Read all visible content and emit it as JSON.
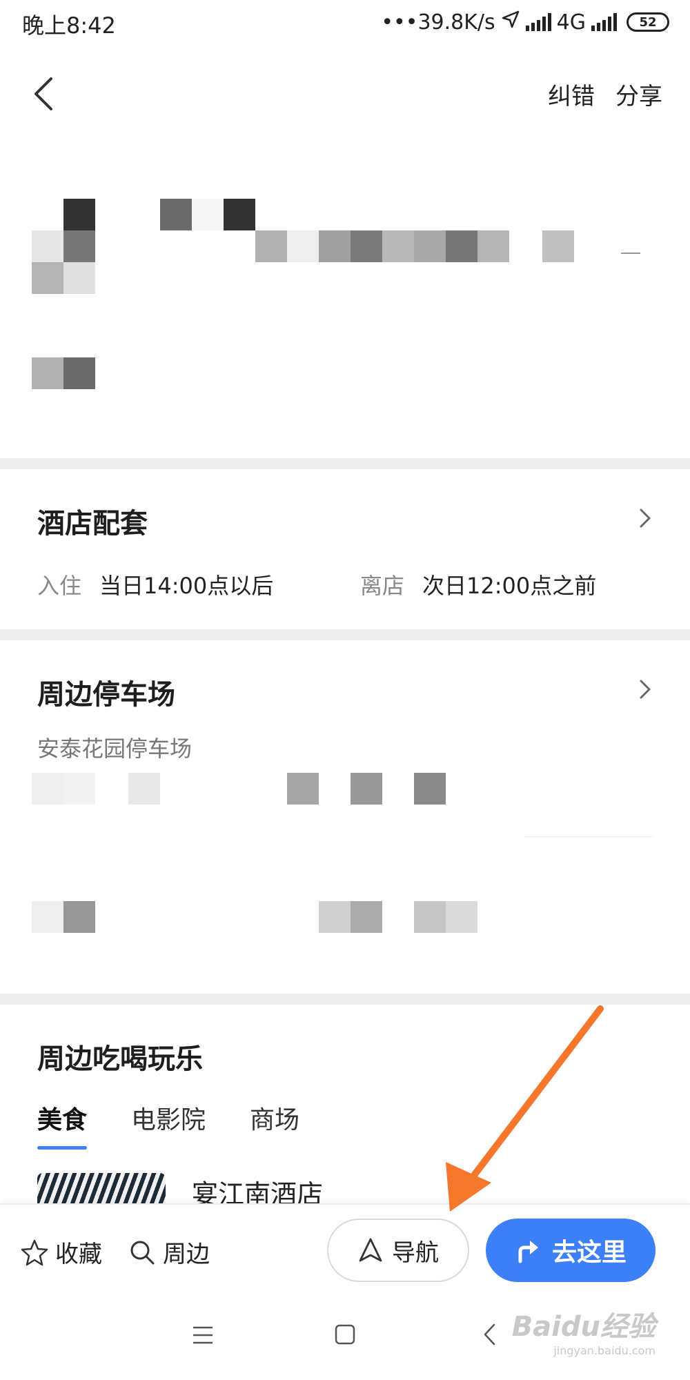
{
  "status_bar": {
    "time": "晚上8:42",
    "network_speed": "•••39.8K/s",
    "network_type": "4G",
    "battery": "52"
  },
  "header": {
    "report_error": "纠错",
    "share": "分享"
  },
  "hotel_facilities": {
    "title": "酒店配套",
    "checkin_label": "入住",
    "checkin_value": "当日14:00点以后",
    "checkout_label": "离店",
    "checkout_value": "次日12:00点之前"
  },
  "parking": {
    "title": "周边停车场",
    "first_lot": "安泰花园停车场"
  },
  "nearby_fun": {
    "title": "周边吃喝玩乐",
    "tabs": [
      {
        "label": "美食",
        "active": true
      },
      {
        "label": "电影院",
        "active": false
      },
      {
        "label": "商场",
        "active": false
      }
    ],
    "first_place": "宴江南酒店"
  },
  "action_bar": {
    "favorite": "收藏",
    "nearby": "周边",
    "navigate": "导航",
    "go_here": "去这里"
  },
  "watermark": {
    "main": "Baidu经验",
    "sub": "jingyan.baidu.com"
  },
  "colors": {
    "accent": "#3d7ff7",
    "annotation_arrow": "#f6772b",
    "divider": "#ececec"
  }
}
